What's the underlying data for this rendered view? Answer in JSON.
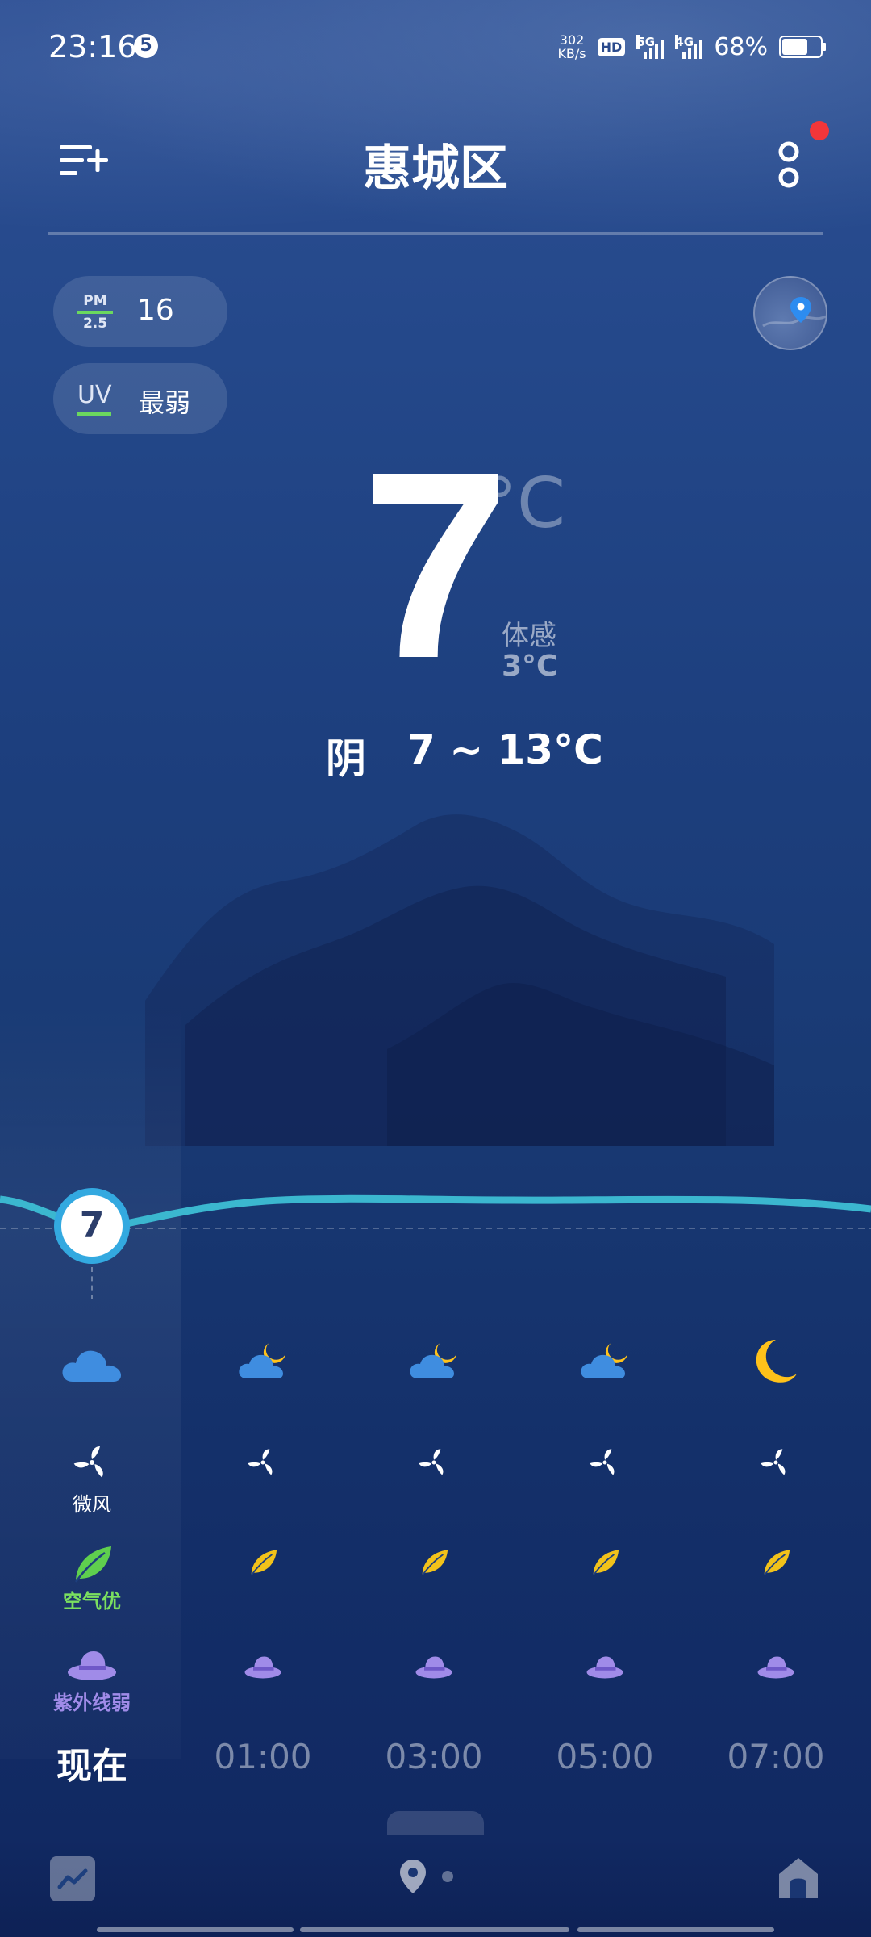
{
  "status_bar": {
    "time": "23:16",
    "notification_count": "5",
    "net_speed_value": "302",
    "net_speed_unit": "KB/s",
    "hd_label": "HD",
    "sim1_label": "5G",
    "sim2_label": "4G",
    "battery_percent": "68%",
    "battery_level": 0.68
  },
  "header": {
    "city": "惠城区",
    "has_notification_dot": true
  },
  "air": {
    "pm_label_top": "PM",
    "pm_label_bottom": "2.5",
    "pm_value": "16",
    "uv_label": "UV",
    "uv_value": "最弱"
  },
  "current": {
    "temperature": "7",
    "unit": "°C",
    "feels_like_label": "体感",
    "feels_like_value": "3°C",
    "condition": "阴",
    "range": "7 ~ 13°C"
  },
  "hourly": {
    "current_temp": "7",
    "wind_label": "微风",
    "air_label": "空气优",
    "uv_label": "紫外线弱",
    "items": [
      {
        "time": "现在",
        "icon": "cloud-icon"
      },
      {
        "time": "01:00",
        "icon": "cloud-moon-icon"
      },
      {
        "time": "03:00",
        "icon": "cloud-moon-icon"
      },
      {
        "time": "05:00",
        "icon": "cloud-moon-icon"
      },
      {
        "time": "07:00",
        "icon": "moon-icon"
      }
    ]
  },
  "colors": {
    "accent_line": "#3bb7cf",
    "node_ring": "#33a9e0",
    "good_green": "#6bd85e",
    "leaf_yellow": "#f2c21a",
    "uv_purple": "#a08be8",
    "moon_yellow": "#ffc21a"
  }
}
